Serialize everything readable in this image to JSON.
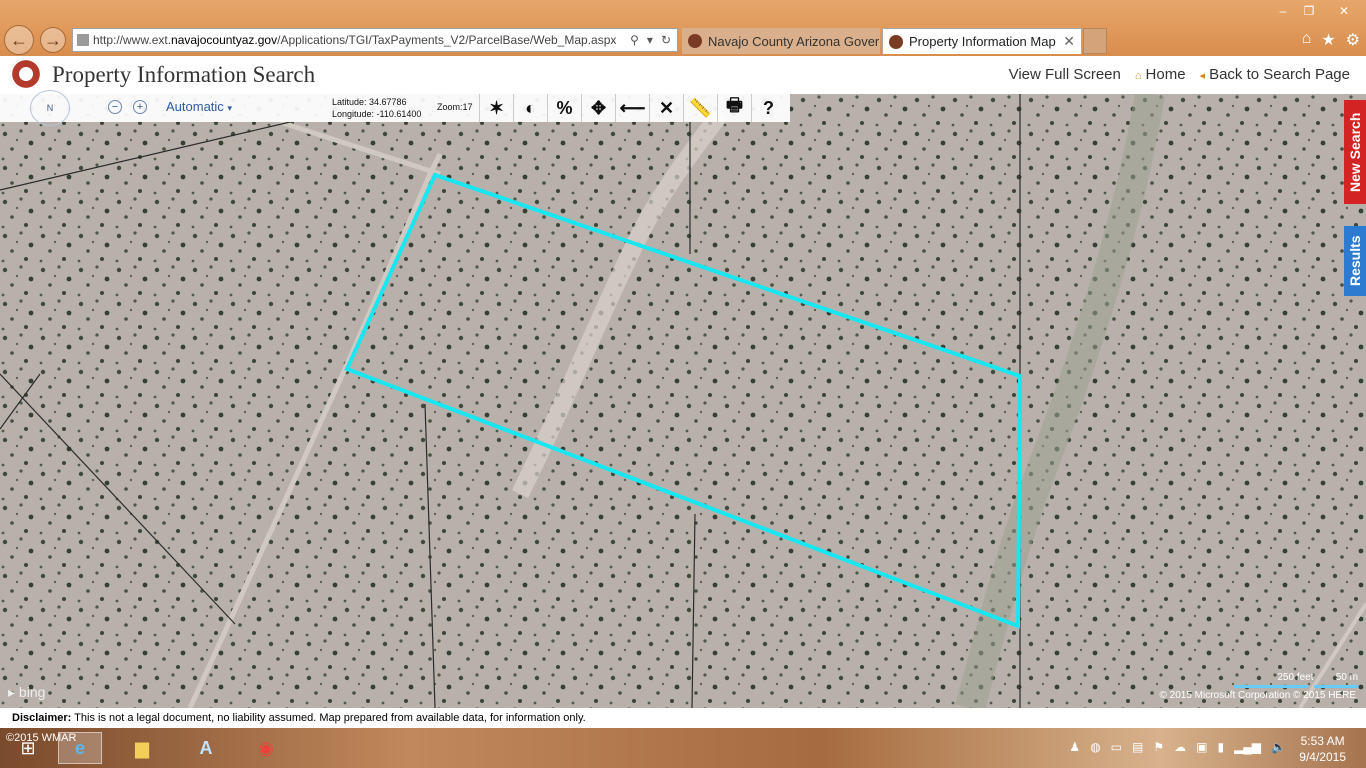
{
  "browser": {
    "url_prefix": "http://www.ext.",
    "url_domain": "navajocountyaz.gov",
    "url_path": "/Applications/TGI/TaxPayments_V2/ParcelBase/Web_Map.aspx",
    "tabs": [
      {
        "label": "Navajo County Arizona Govern..."
      },
      {
        "label": "Property Information Map"
      }
    ]
  },
  "header": {
    "title": "Property Information Search",
    "links": {
      "full_screen": "View Full Screen",
      "home": "Home",
      "back": "Back to Search Page"
    }
  },
  "toolbar": {
    "compass_label": "N",
    "zoom_out": "−",
    "zoom_in": "+",
    "map_style": "Automatic",
    "latitude": "Latitude: 34.67786",
    "longitude": "Longitude: -110.61400",
    "zoom": "Zoom:17",
    "tools": {
      "measure_area": "◐",
      "percent": "%",
      "pan": "✥",
      "back": "⟵",
      "clear": "✕",
      "ruler": "📏",
      "print": "🖶",
      "help": "?"
    }
  },
  "side_tabs": {
    "new_search": "New Search",
    "results": "Results"
  },
  "map": {
    "bing_label": "bing",
    "scale_feet": "250 feet",
    "scale_m": "50 m",
    "copyright": "© 2015 Microsoft Corporation   © 2015 HERE",
    "parcel_color": "#18e6f0"
  },
  "disclaimer": {
    "label": "Disclaimer:",
    "text": "This is not a legal document, no liability assumed. Map prepared from available data, for information only."
  },
  "taskbar": {
    "watermark": "©2015 WMAR",
    "time": "5:53 AM",
    "date": "9/4/2015"
  }
}
